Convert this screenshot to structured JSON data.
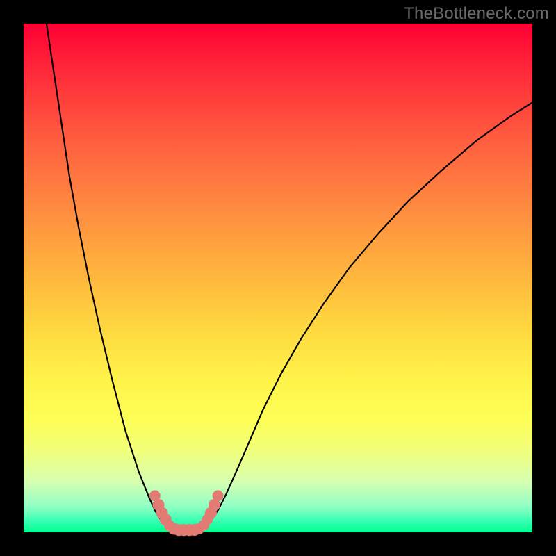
{
  "watermark": "TheBottleneck.com",
  "chart_data": {
    "type": "line",
    "title": "",
    "xlabel": "",
    "ylabel": "",
    "xlim": [
      0,
      100
    ],
    "ylim": [
      0,
      100
    ],
    "grid": false,
    "series": [
      {
        "name": "curve-left",
        "values": [
          {
            "x": 4.5,
            "y": 100
          },
          {
            "x": 6.0,
            "y": 90
          },
          {
            "x": 7.5,
            "y": 80
          },
          {
            "x": 9.0,
            "y": 70
          },
          {
            "x": 10.8,
            "y": 60
          },
          {
            "x": 12.8,
            "y": 50
          },
          {
            "x": 15.0,
            "y": 40
          },
          {
            "x": 17.4,
            "y": 30
          },
          {
            "x": 20.0,
            "y": 20
          },
          {
            "x": 22.6,
            "y": 12
          },
          {
            "x": 24.8,
            "y": 6.5
          },
          {
            "x": 26.0,
            "y": 4.0
          },
          {
            "x": 27.0,
            "y": 2.4
          },
          {
            "x": 28.0,
            "y": 1.2
          },
          {
            "x": 29.2,
            "y": 0.55
          },
          {
            "x": 30.5,
            "y": 0.45
          },
          {
            "x": 32.5,
            "y": 0.45
          },
          {
            "x": 34.5,
            "y": 0.55
          },
          {
            "x": 35.8,
            "y": 1.3
          },
          {
            "x": 37.0,
            "y": 2.6
          },
          {
            "x": 38.3,
            "y": 4.5
          },
          {
            "x": 39.8,
            "y": 7.5
          },
          {
            "x": 41.6,
            "y": 11.5
          },
          {
            "x": 44.0,
            "y": 17
          },
          {
            "x": 47.0,
            "y": 24
          },
          {
            "x": 50.5,
            "y": 31
          },
          {
            "x": 54.5,
            "y": 38
          },
          {
            "x": 59.0,
            "y": 45
          },
          {
            "x": 64.0,
            "y": 52
          },
          {
            "x": 69.5,
            "y": 58.5
          },
          {
            "x": 75.5,
            "y": 65
          },
          {
            "x": 82.0,
            "y": 71
          },
          {
            "x": 89.0,
            "y": 77
          },
          {
            "x": 96.0,
            "y": 82
          },
          {
            "x": 100.0,
            "y": 84.5
          }
        ]
      }
    ],
    "markers": [
      {
        "name": "marker-dot",
        "x": 25.8,
        "y": 7.2,
        "r": 1.2
      },
      {
        "name": "marker-dot",
        "x": 26.5,
        "y": 5.4,
        "r": 1.3
      },
      {
        "name": "marker-dot",
        "x": 27.2,
        "y": 3.8,
        "r": 1.3
      },
      {
        "name": "marker-dot",
        "x": 27.9,
        "y": 2.5,
        "r": 1.3
      },
      {
        "name": "marker-dot",
        "x": 28.7,
        "y": 1.3,
        "r": 1.2
      },
      {
        "name": "marker-dot",
        "x": 29.5,
        "y": 0.7,
        "r": 1.3
      },
      {
        "name": "marker-dot",
        "x": 30.5,
        "y": 0.45,
        "r": 1.3
      },
      {
        "name": "marker-dot",
        "x": 31.5,
        "y": 0.45,
        "r": 1.3
      },
      {
        "name": "marker-dot",
        "x": 32.6,
        "y": 0.45,
        "r": 1.3
      },
      {
        "name": "marker-dot",
        "x": 33.6,
        "y": 0.48,
        "r": 1.3
      },
      {
        "name": "marker-dot",
        "x": 34.5,
        "y": 0.7,
        "r": 1.2
      },
      {
        "name": "marker-dot",
        "x": 35.4,
        "y": 1.4,
        "r": 1.2
      },
      {
        "name": "marker-dot",
        "x": 36.1,
        "y": 2.5,
        "r": 1.2
      },
      {
        "name": "marker-dot",
        "x": 36.8,
        "y": 3.8,
        "r": 1.3
      },
      {
        "name": "marker-dot",
        "x": 37.5,
        "y": 5.4,
        "r": 1.3
      },
      {
        "name": "marker-dot",
        "x": 38.2,
        "y": 7.2,
        "r": 1.2
      }
    ],
    "marker_color": "#e27b74",
    "marker_stroke": "#b84d45",
    "curve_color": "#000000",
    "curve_width": 2.2
  }
}
